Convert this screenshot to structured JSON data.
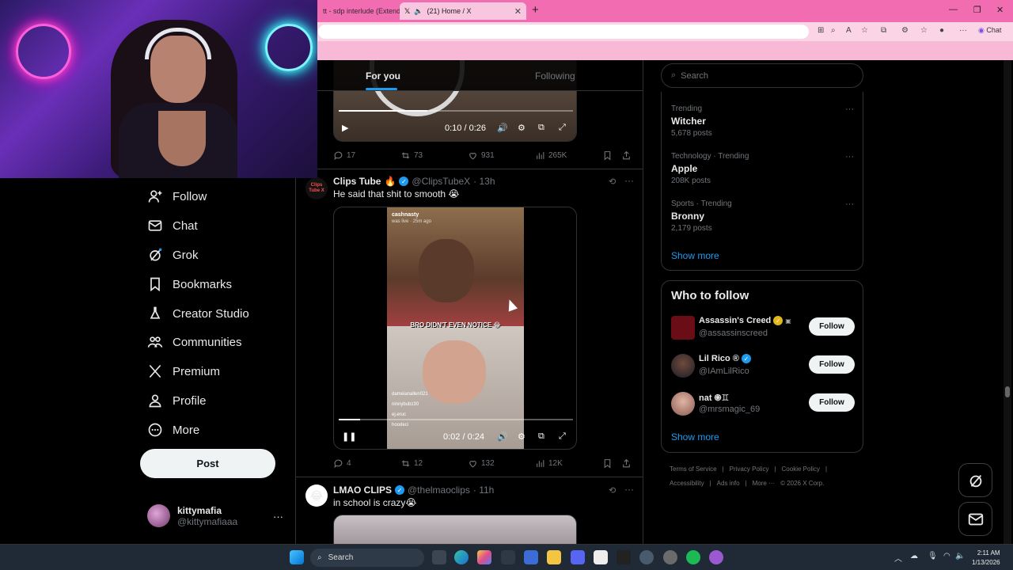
{
  "browser": {
    "tabs": [
      {
        "label": "tt - sdp interlude (Extend"
      },
      {
        "label": "(21) Home / X"
      }
    ],
    "chat_label": "Chat"
  },
  "nav": {
    "items": [
      {
        "label": "Follow"
      },
      {
        "label": "Chat"
      },
      {
        "label": "Grok"
      },
      {
        "label": "Bookmarks"
      },
      {
        "label": "Creator Studio"
      },
      {
        "label": "Communities"
      },
      {
        "label": "Premium"
      },
      {
        "label": "Profile"
      },
      {
        "label": "More"
      }
    ],
    "post_label": "Post",
    "account": {
      "name": "kittymafia",
      "handle": "@kittymafiaaa"
    }
  },
  "feed": {
    "tab_for_you": "For you",
    "tab_following": "Following",
    "video1": {
      "time": "0:10 / 0:26",
      "progress": 0.38
    },
    "tweet1_stats": {
      "replies": "17",
      "reposts": "73",
      "likes": "931",
      "views": "265K"
    },
    "tweet2": {
      "name": "Clips Tube",
      "emoji": "🔥",
      "handle": "@ClipsTubeX",
      "age": "· 13h",
      "text": "He said that shit to smooth 😭",
      "avatar_text": "Clips Tube X",
      "video_overlay": "BRO DIDN'T EVEN NOTICE 😂",
      "video_user": "cashnasty",
      "video_user_sub": "was live · 25m ago",
      "comments": [
        "dameianallen021",
        "ninnybubz30",
        "ej.eruc",
        "hoodeci"
      ],
      "time": "0:02 / 0:24",
      "progress": 0.09,
      "stats": {
        "replies": "4",
        "reposts": "12",
        "likes": "132",
        "views": "12K"
      }
    },
    "tweet3": {
      "name": "LMAO CLIPS",
      "handle": "@thelmaoclips",
      "age": "· 11h",
      "text": "in school is crazy😭"
    }
  },
  "right": {
    "search_placeholder": "Search",
    "trends": [
      {
        "meta": "Trending",
        "name": "Witcher",
        "count": "5,678 posts"
      },
      {
        "meta": "Technology · Trending",
        "name": "Apple",
        "count": "208K posts"
      },
      {
        "meta": "Sports · Trending",
        "name": "Bronny",
        "count": "2,179 posts"
      }
    ],
    "show_more": "Show more",
    "wtf_title": "Who to follow",
    "wtf": [
      {
        "name": "Assassin's Creed",
        "handle": "@assassinscreed",
        "badge": "gold"
      },
      {
        "name": "Lil Rico ®",
        "handle": "@IAmLilRico",
        "badge": "blue"
      },
      {
        "name": "nat ֎♊",
        "handle": "@mrsmagic_69",
        "badge": "none"
      }
    ],
    "follow_label": "Follow",
    "wtf_show_more": "Show more",
    "footer_row1": [
      "Terms of Service",
      "Privacy Policy",
      "Cookie Policy"
    ],
    "footer_row2": [
      "Accessibility",
      "Ads info",
      "More ···",
      "© 2026 X Corp."
    ]
  },
  "taskbar": {
    "search_label": "Search",
    "time": "2:11 AM",
    "date": "1/13/2026"
  },
  "colors": {
    "accent": "#1d9bf0",
    "tab_bar": "#f16cb0",
    "address_bar": "#fbd4e6",
    "border": "#2f3336",
    "muted": "#71767b"
  }
}
